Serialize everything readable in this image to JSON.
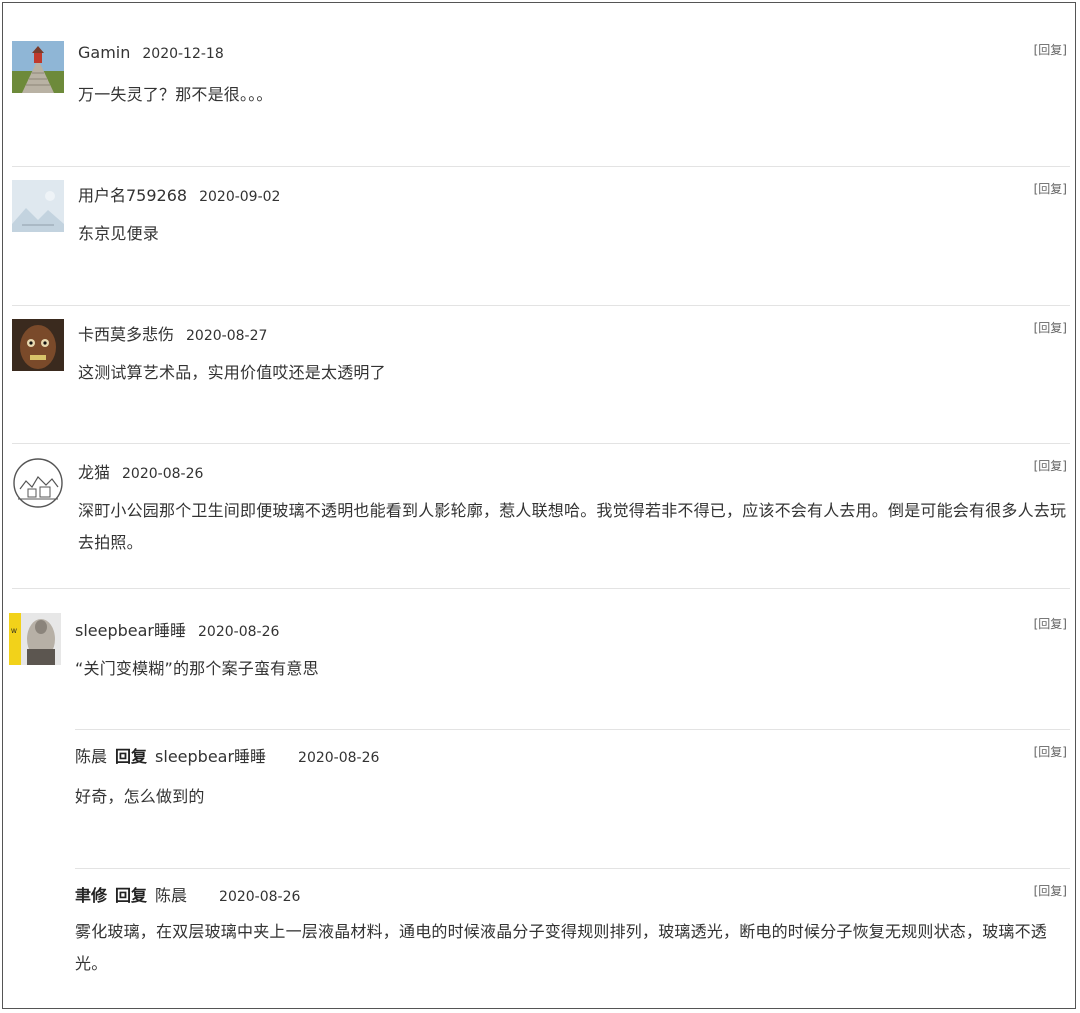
{
  "reply_label": "[回复]",
  "comments": [
    {
      "name": "Gamin",
      "date": "2020-12-18",
      "text": "万一失灵了？那不是很。。。"
    },
    {
      "name": "用户名759268",
      "date": "2020-09-02",
      "text": "东京见便录"
    },
    {
      "name": "卡西莫多悲伤",
      "date": "2020-08-27",
      "text": "这测试算艺术品，实用价值哎还是太透明了"
    },
    {
      "name": "龙猫",
      "date": "2020-08-26",
      "text": "深町小公园那个卫生间即便玻璃不透明也能看到人影轮廓，惹人联想哈。我觉得若非不得已，应该不会有人去用。倒是可能会有很多人去玩去拍照。"
    },
    {
      "name": "sleepbear睡睡",
      "date": "2020-08-26",
      "text": "“关门变模糊”的那个案子蛮有意思"
    }
  ],
  "replies": [
    {
      "name": "陈晨",
      "verb": "回复",
      "target": "sleepbear睡睡",
      "date": "2020-08-26",
      "text": "好奇，怎么做到的"
    },
    {
      "name": "聿修",
      "verb": "回复",
      "target": "陈晨",
      "date": "2020-08-26",
      "text": "雾化玻璃，在双层玻璃中夹上一层液晶材料，通电的时候液晶分子变得规则排列，玻璃透光，断电的时候分子恢复无规则状态，玻璃不透光。"
    }
  ]
}
